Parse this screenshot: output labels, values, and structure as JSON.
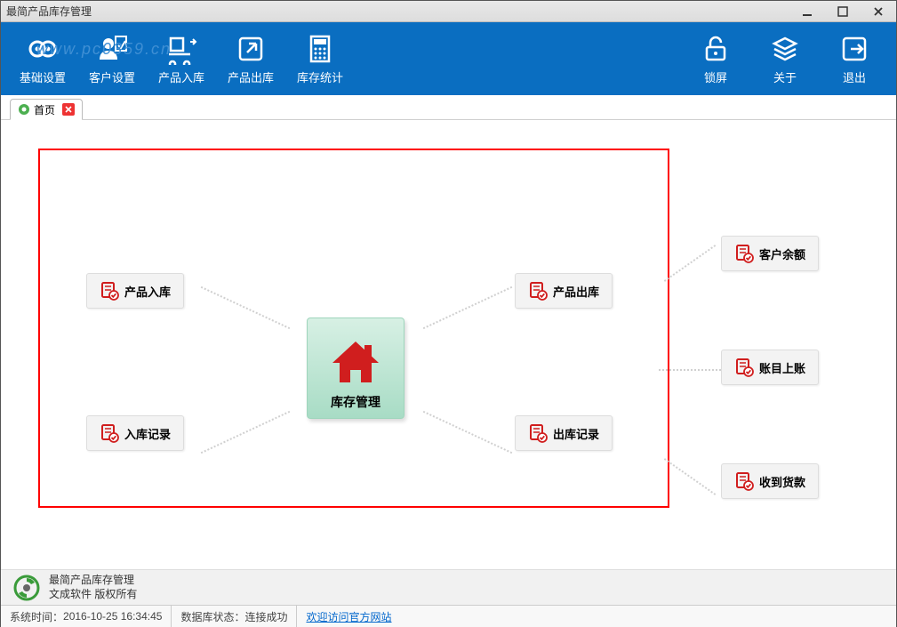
{
  "window": {
    "title": "最简产品库存管理"
  },
  "toolbar": {
    "left": [
      {
        "id": "basic-setup",
        "label": "基础设置",
        "icon": "gear-icon"
      },
      {
        "id": "customer-setup",
        "label": "客户设置",
        "icon": "user-icon"
      },
      {
        "id": "product-in",
        "label": "产品入库",
        "icon": "cart-in-icon"
      },
      {
        "id": "product-out",
        "label": "产品出库",
        "icon": "share-icon"
      },
      {
        "id": "stock-stats",
        "label": "库存统计",
        "icon": "calculator-icon"
      }
    ],
    "right": [
      {
        "id": "lock",
        "label": "锁屏",
        "icon": "lock-icon"
      },
      {
        "id": "about",
        "label": "关于",
        "icon": "layers-icon"
      },
      {
        "id": "exit",
        "label": "退出",
        "icon": "exit-icon"
      }
    ],
    "watermark": "www.pc0359.cn"
  },
  "tabs": [
    {
      "label": "首页",
      "active": true
    }
  ],
  "center_node": {
    "label": "库存管理"
  },
  "nodes_inside": {
    "top_left": {
      "label": "产品入库"
    },
    "bottom_left": {
      "label": "入库记录"
    },
    "top_right": {
      "label": "产品出库"
    },
    "bottom_right": {
      "label": "出库记录"
    }
  },
  "nodes_outside": [
    {
      "label": "客户余额"
    },
    {
      "label": "账目上账"
    },
    {
      "label": "收到货款"
    }
  ],
  "footer": {
    "line1": "最简产品库存管理",
    "line2": "文成软件  版权所有"
  },
  "status": {
    "time_label": "系统时间：",
    "time_value": "2016-10-25 16:34:45",
    "db_label": "数据库状态：",
    "db_value": "连接成功",
    "link": "欢迎访问官方网站"
  },
  "colors": {
    "toolbar_bg": "#0a6ec1",
    "accent_red": "#d01e1e",
    "node_bg": "#f3f3f3",
    "center_bg": "#c3e6d6"
  }
}
